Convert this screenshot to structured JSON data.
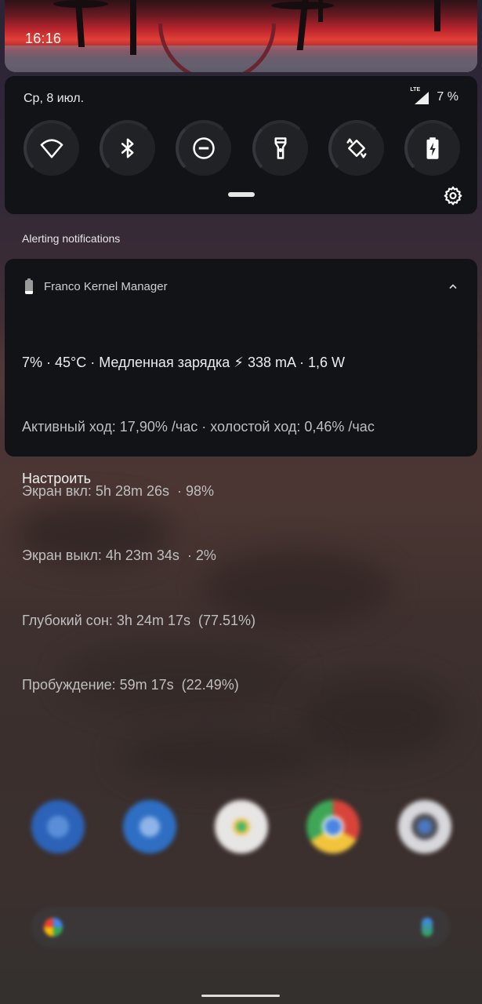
{
  "status_bar": {
    "time": "16:16"
  },
  "quick_settings": {
    "date": "Ср, 8 июл.",
    "network_type": "LTE",
    "battery_percent": "7 %",
    "tiles": [
      {
        "name": "wifi",
        "icon": "wifi-icon"
      },
      {
        "name": "bluetooth",
        "icon": "bluetooth-icon"
      },
      {
        "name": "do-not-disturb",
        "icon": "do-not-disturb-icon"
      },
      {
        "name": "flashlight",
        "icon": "flashlight-icon"
      },
      {
        "name": "auto-rotate",
        "icon": "auto-rotate-icon"
      },
      {
        "name": "battery-saver",
        "icon": "battery-charging-icon"
      }
    ]
  },
  "section_label": "Alerting notifications",
  "notification": {
    "app_name": "Franco Kernel Manager",
    "lines": [
      "7% · 45°C · Медленная зарядка ⚡ 338 mA · 1,6 W",
      "Активный ход: 17,90% /час · холостой ход: 0,46% /час",
      "Экран вкл: 5h 28m 26s  · 98%",
      "Экран выкл: 4h 23m 34s  · 2%",
      "Глубокий сон: 3h 24m 17s  (77.51%)",
      "Пробуждение: 59m 17s  (22.49%)"
    ]
  },
  "customize_label": "Настроить",
  "colors": {
    "panel_bg": "#121317",
    "tile_bg": "#202226",
    "text_primary": "#ececec",
    "text_secondary": "#bfbfbf"
  },
  "dock": {
    "apps": [
      "phone-icon",
      "messages-icon",
      "play-store-icon",
      "chrome-icon",
      "camera-icon"
    ]
  }
}
